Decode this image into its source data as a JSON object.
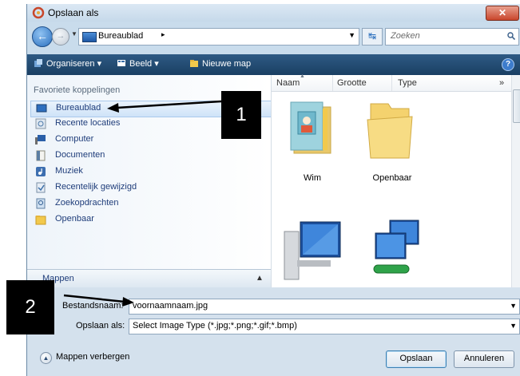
{
  "window": {
    "title": "Opslaan als"
  },
  "address_bar": {
    "location": "Bureaublad",
    "separator": "▸",
    "search_placeholder": "Zoeken"
  },
  "toolbar": {
    "organize": "Organiseren",
    "view": "Beeld",
    "new_folder": "Nieuwe map"
  },
  "nav_pane": {
    "header": "Favoriete koppelingen",
    "items": [
      {
        "label": "Bureaublad",
        "icon": "desktop-icon",
        "selected": true
      },
      {
        "label": "Recente locaties",
        "icon": "recent-places-icon",
        "selected": false
      },
      {
        "label": "Computer",
        "icon": "computer-icon",
        "selected": false
      },
      {
        "label": "Documenten",
        "icon": "documents-icon",
        "selected": false
      },
      {
        "label": "Muziek",
        "icon": "music-icon",
        "selected": false
      },
      {
        "label": "Recentelijk gewijzigd",
        "icon": "recently-changed-icon",
        "selected": false
      },
      {
        "label": "Zoekopdrachten",
        "icon": "searches-icon",
        "selected": false
      },
      {
        "label": "Openbaar",
        "icon": "public-folder-icon",
        "selected": false
      }
    ],
    "folders_label": "Mappen"
  },
  "columns": {
    "name": "Naam",
    "size": "Grootte",
    "type": "Type",
    "more": "»"
  },
  "files": [
    {
      "label": "Wim",
      "icon": "user-folder-icon"
    },
    {
      "label": "Openbaar",
      "icon": "folder-icon"
    },
    {
      "label": "",
      "icon": "computer-icon"
    },
    {
      "label": "",
      "icon": "network-icon"
    }
  ],
  "form": {
    "filename_label": "Bestandsnaam:",
    "filename_value": "voornaamnaam.jpg",
    "savetype_label": "Opslaan als:",
    "savetype_value": "Select Image Type  (*.jpg;*.png;*.gif;*.bmp)"
  },
  "buttons": {
    "hide_folders": "Mappen verbergen",
    "save": "Opslaan",
    "cancel": "Annuleren"
  },
  "callouts": {
    "one": "1",
    "two": "2"
  },
  "colors": {
    "toolbar": "#1a3f63",
    "callout": "#000000",
    "link": "#1f3d7a"
  }
}
